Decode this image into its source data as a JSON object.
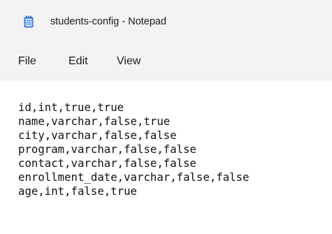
{
  "window": {
    "title": "students-config - Notepad"
  },
  "menu": {
    "file": "File",
    "edit": "Edit",
    "view": "View"
  },
  "editor": {
    "lines": [
      "id,int,true,true",
      "name,varchar,false,true",
      "city,varchar,false,false",
      "program,varchar,false,false",
      "contact,varchar,false,false",
      "enrollment_date,varchar,false,false",
      "age,int,false,true"
    ]
  },
  "icons": {
    "app": "notepad-icon"
  },
  "colors": {
    "chrome": "#f3f3f3",
    "editor_bg": "#ffffff",
    "icon_accent": "#3c7de0"
  }
}
